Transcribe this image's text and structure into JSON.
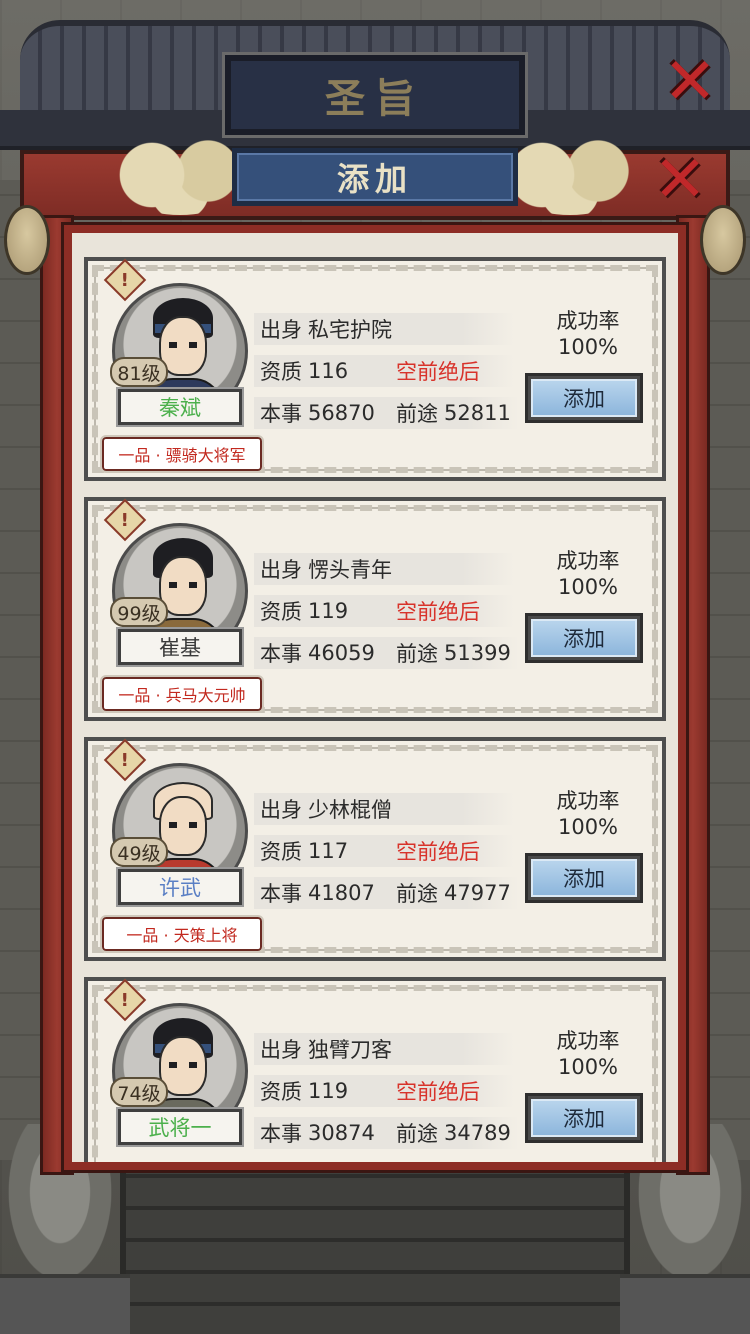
{
  "header": {
    "plaque_title": "圣旨",
    "banner_title": "添加"
  },
  "labels": {
    "origin": "出身",
    "aptitude": "资质",
    "skill": "本事",
    "future": "前途",
    "success_rate": "成功率",
    "add_button": "添加"
  },
  "candidates": [
    {
      "level": "81级",
      "name": "秦斌",
      "name_color": "green",
      "rank": "一品 · 骠骑大将军",
      "origin": "私宅护院",
      "aptitude": "116",
      "tier": "空前绝后",
      "skill": "56870",
      "future": "52811",
      "success_rate": "100%"
    },
    {
      "level": "99级",
      "name": "崔基",
      "name_color": "dark",
      "rank": "一品 · 兵马大元帅",
      "origin": "愣头青年",
      "aptitude": "119",
      "tier": "空前绝后",
      "skill": "46059",
      "future": "51399",
      "success_rate": "100%"
    },
    {
      "level": "49级",
      "name": "许武",
      "name_color": "blue",
      "rank": "一品 · 天策上将",
      "origin": "少林棍僧",
      "aptitude": "117",
      "tier": "空前绝后",
      "skill": "41807",
      "future": "47977",
      "success_rate": "100%"
    },
    {
      "level": "74级",
      "name": "武将一",
      "name_color": "green",
      "rank": "",
      "origin": "独臂刀客",
      "aptitude": "119",
      "tier": "空前绝后",
      "skill": "30874",
      "future": "34789",
      "success_rate": "100%"
    }
  ],
  "colors": {
    "tier_red": "#d8332b",
    "frame_red": "#8d2d25",
    "button_blue": "#8db6dc"
  }
}
